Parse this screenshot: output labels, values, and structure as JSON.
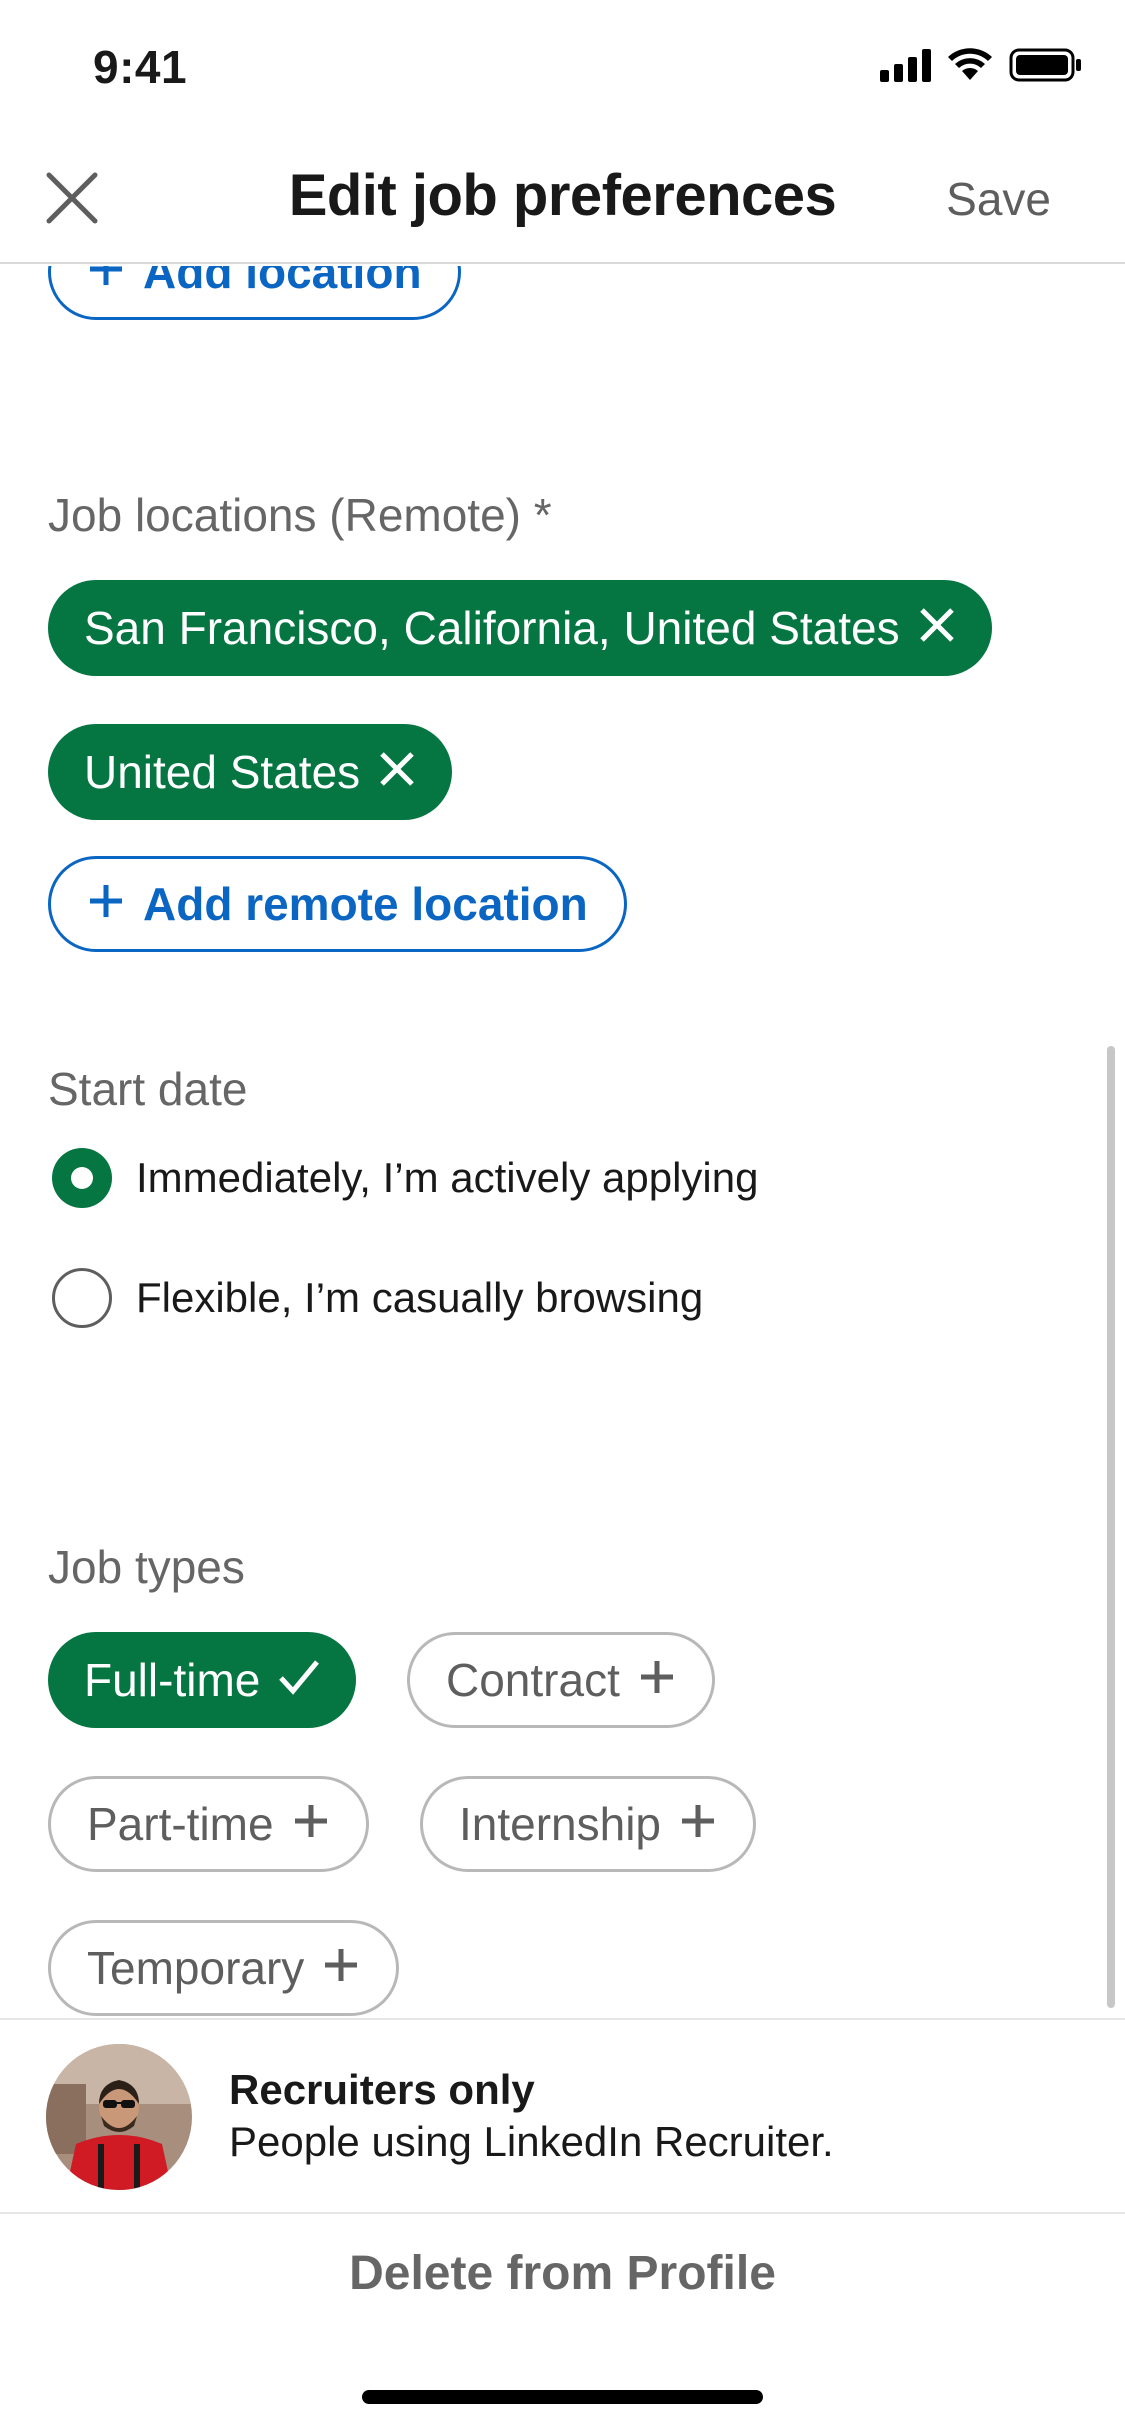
{
  "status_bar": {
    "time": "9:41"
  },
  "header": {
    "title": "Edit job preferences",
    "save_label": "Save"
  },
  "locations": {
    "add_location_label": "Add location"
  },
  "remote_locations": {
    "label": "Job locations (Remote) *",
    "chips": [
      {
        "label": "San Francisco, California, United States"
      },
      {
        "label": "United States"
      }
    ],
    "add_label": "Add remote location"
  },
  "start_date": {
    "label": "Start date",
    "options": [
      {
        "label": "Immediately, I’m actively applying",
        "selected": true
      },
      {
        "label": "Flexible, I’m casually browsing",
        "selected": false
      }
    ]
  },
  "job_types": {
    "label": "Job types",
    "chips": [
      {
        "label": "Full-time",
        "selected": true
      },
      {
        "label": "Contract",
        "selected": false
      },
      {
        "label": "Part-time",
        "selected": false
      },
      {
        "label": "Internship",
        "selected": false
      },
      {
        "label": "Temporary",
        "selected": false
      }
    ]
  },
  "visibility": {
    "title": "Recruiters only",
    "subtitle": "People using LinkedIn Recruiter."
  },
  "footer": {
    "delete_label": "Delete from Profile"
  },
  "colors": {
    "accent_blue": "#0a66c2",
    "accent_green": "#057642",
    "muted_text": "#666666"
  }
}
